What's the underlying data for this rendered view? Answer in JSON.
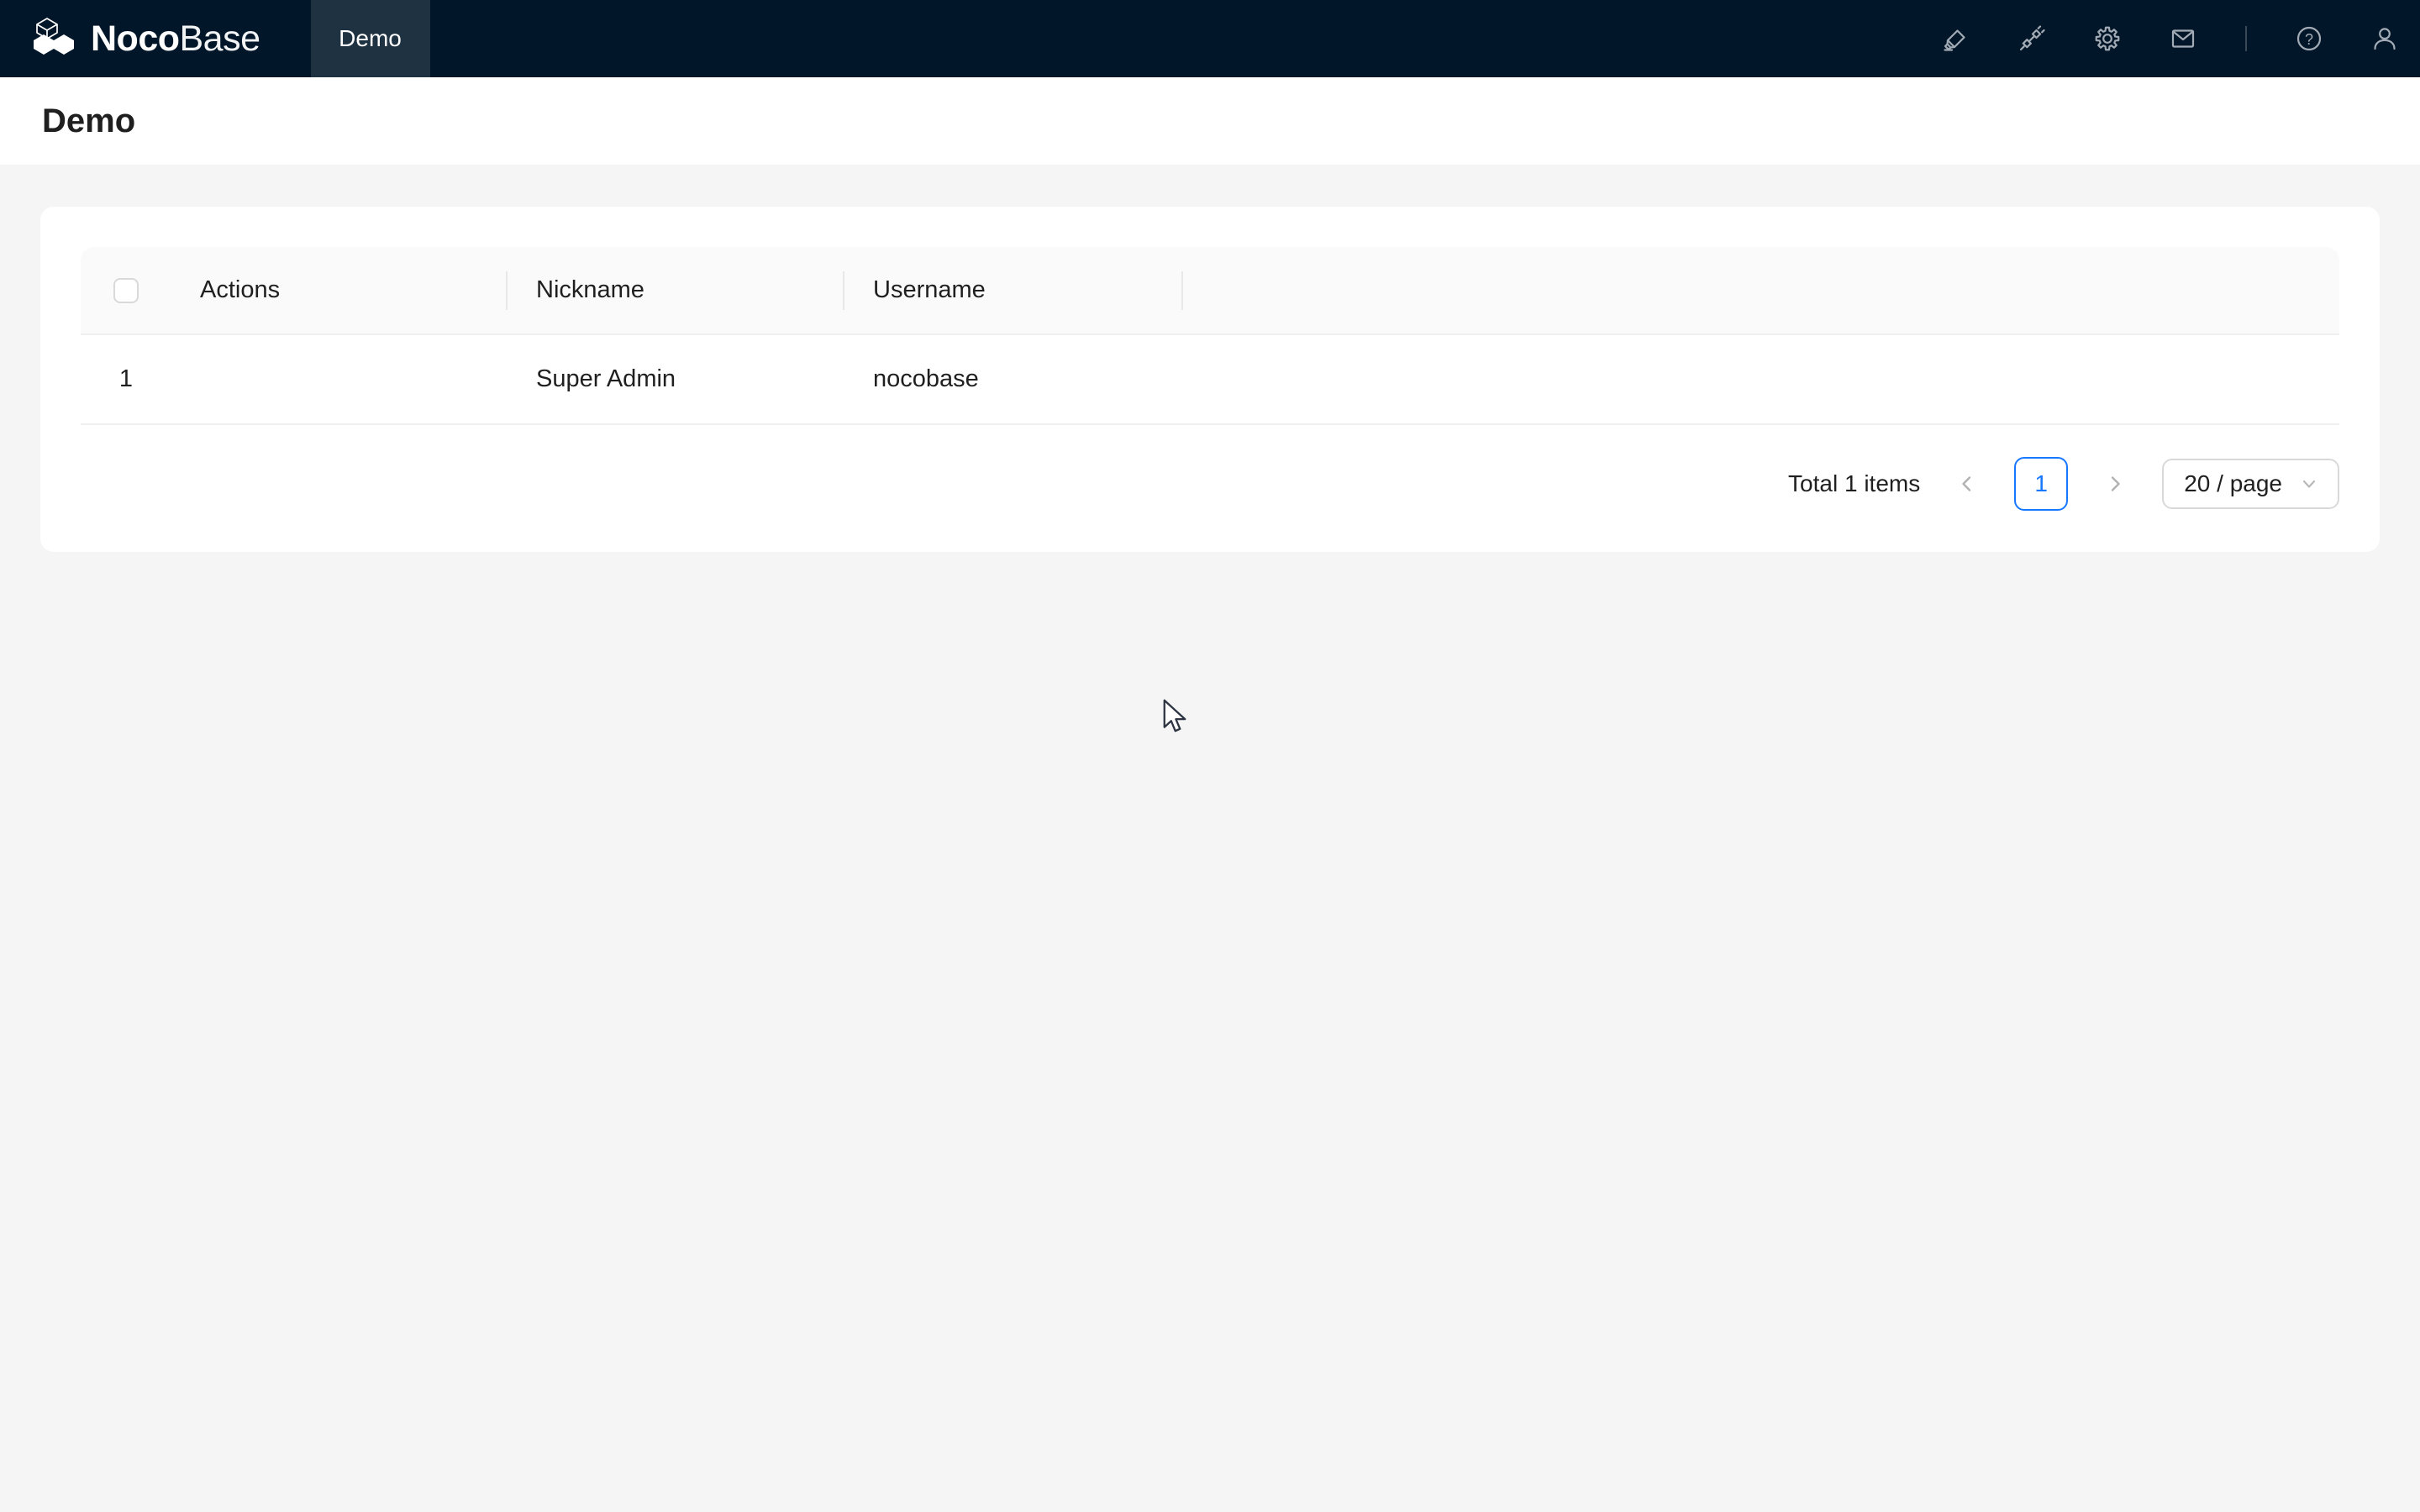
{
  "navbar": {
    "logo_bold": "Noco",
    "logo_light": "Base",
    "tab_label": "Demo",
    "icons": [
      "highlight-icon",
      "plugin-icon",
      "settings-icon",
      "mail-icon",
      "help-icon",
      "user-icon"
    ],
    "help_glyph": "?"
  },
  "page": {
    "title": "Demo"
  },
  "table": {
    "columns": [
      "",
      "Actions",
      "Nickname",
      "Username"
    ],
    "rows": [
      {
        "index": "1",
        "actions": "",
        "nickname": "Super Admin",
        "username": "nocobase"
      }
    ]
  },
  "pagination": {
    "total_label": "Total 1 items",
    "page": "1",
    "page_size": "20 / page"
  },
  "colors": {
    "primary": "#1677ff",
    "navbar_bg": "#011628",
    "navbar_tab_bg": "rgba(255,255,255,0.12)",
    "icon_color": "#a2abb5",
    "body_bg": "#f5f5f5",
    "page_header_bg": "#ffffff",
    "table_header_bg": "#fafafa",
    "row_divider": "#f0f0f0",
    "control_border": "#d9d9d9"
  }
}
